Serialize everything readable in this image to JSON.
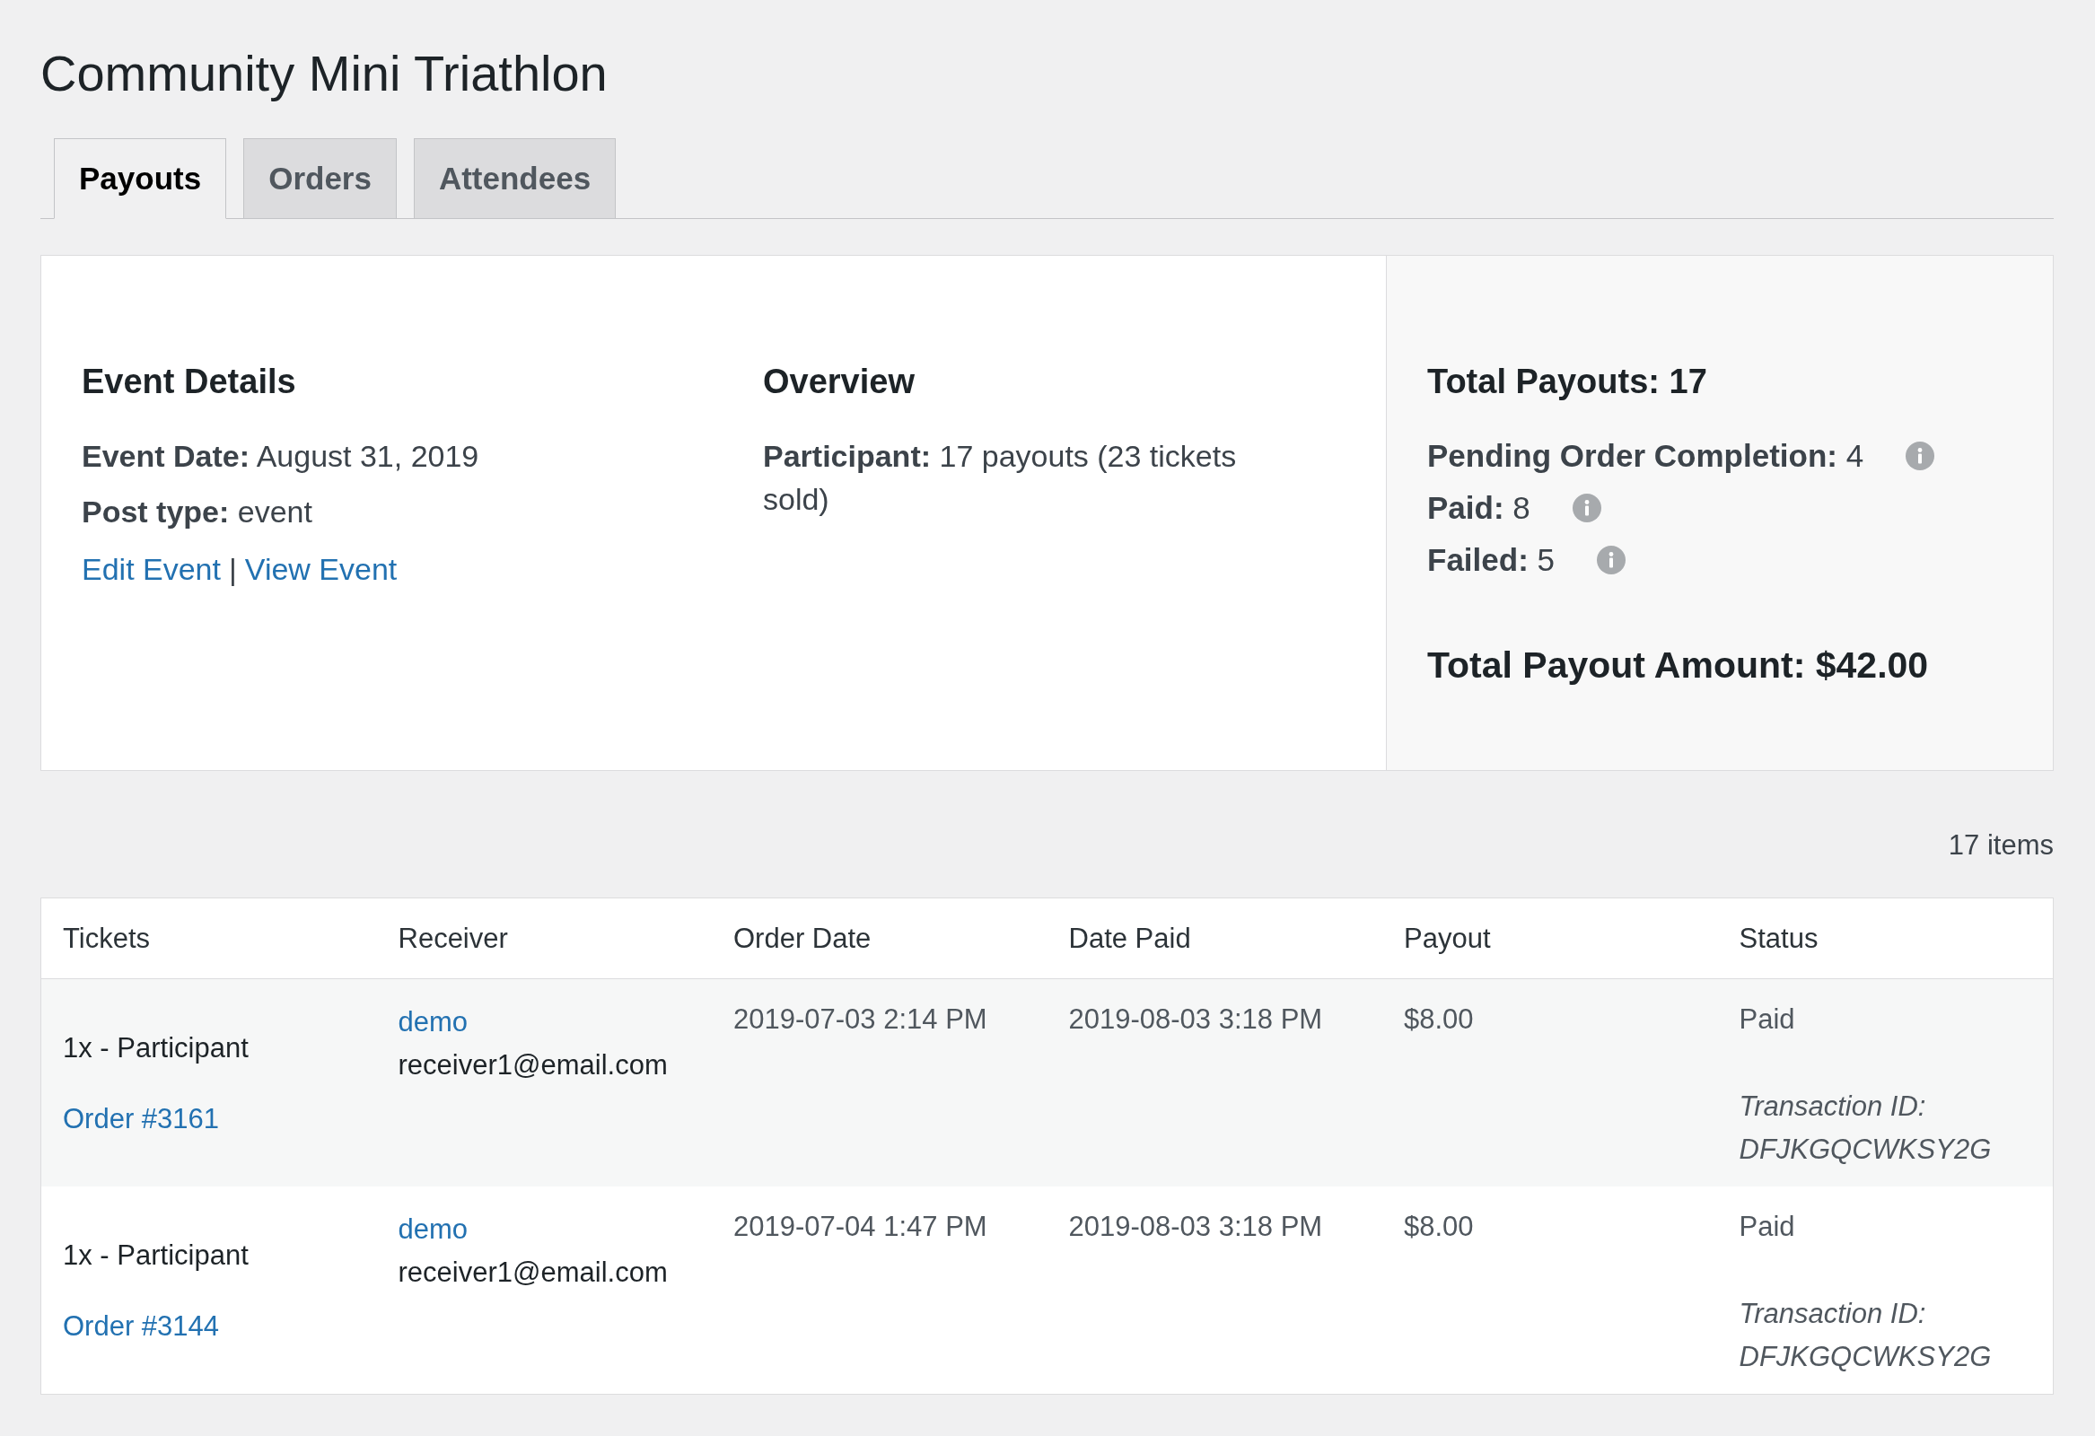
{
  "page": {
    "title": "Community Mini Triathlon"
  },
  "tabs": [
    {
      "label": "Payouts",
      "selected": true
    },
    {
      "label": "Orders",
      "selected": false
    },
    {
      "label": "Attendees",
      "selected": false
    }
  ],
  "event_details": {
    "heading": "Event Details",
    "lines": [
      "**Event Date:** August 31, 2019",
      "**Post type:** event"
    ],
    "links": [
      "Edit Event",
      "View Event"
    ],
    "separator": "|"
  },
  "overview": {
    "heading": "Overview",
    "lines": [
      "**Participant:** 17 payouts (23 tickets sold)"
    ]
  },
  "summary": {
    "heading": "Total Payouts: 17",
    "counts": [
      "**Pending Order Completion:** 4",
      "**Paid:** 8",
      "**Failed:** 5"
    ],
    "total": "Total Payout Amount: $42.00"
  },
  "item_count": "17 items",
  "table": {
    "columns": [
      "Tickets",
      "Receiver",
      "Order Date",
      "Date Paid",
      "Payout",
      "Status"
    ],
    "rows": [
      {
        "ticket": "1x - Participant",
        "order_link": "Order #3161",
        "receiver_name": "demo",
        "receiver_email": "receiver1@email.com",
        "order_date": "2019-07-03 2:14 PM",
        "date_paid": "2019-08-03 3:18 PM",
        "payout": "$8.00",
        "status": "Paid",
        "transaction": "Transaction ID: DFJKGQCWKSY2G"
      },
      {
        "ticket": "1x - Participant",
        "order_link": "Order #3144",
        "receiver_name": "demo",
        "receiver_email": "receiver1@email.com",
        "order_date": "2019-07-04 1:47 PM",
        "date_paid": "2019-08-03 3:18 PM",
        "payout": "$8.00",
        "status": "Paid",
        "transaction": "Transaction ID: DFJKGQCWKSY2G"
      }
    ]
  }
}
